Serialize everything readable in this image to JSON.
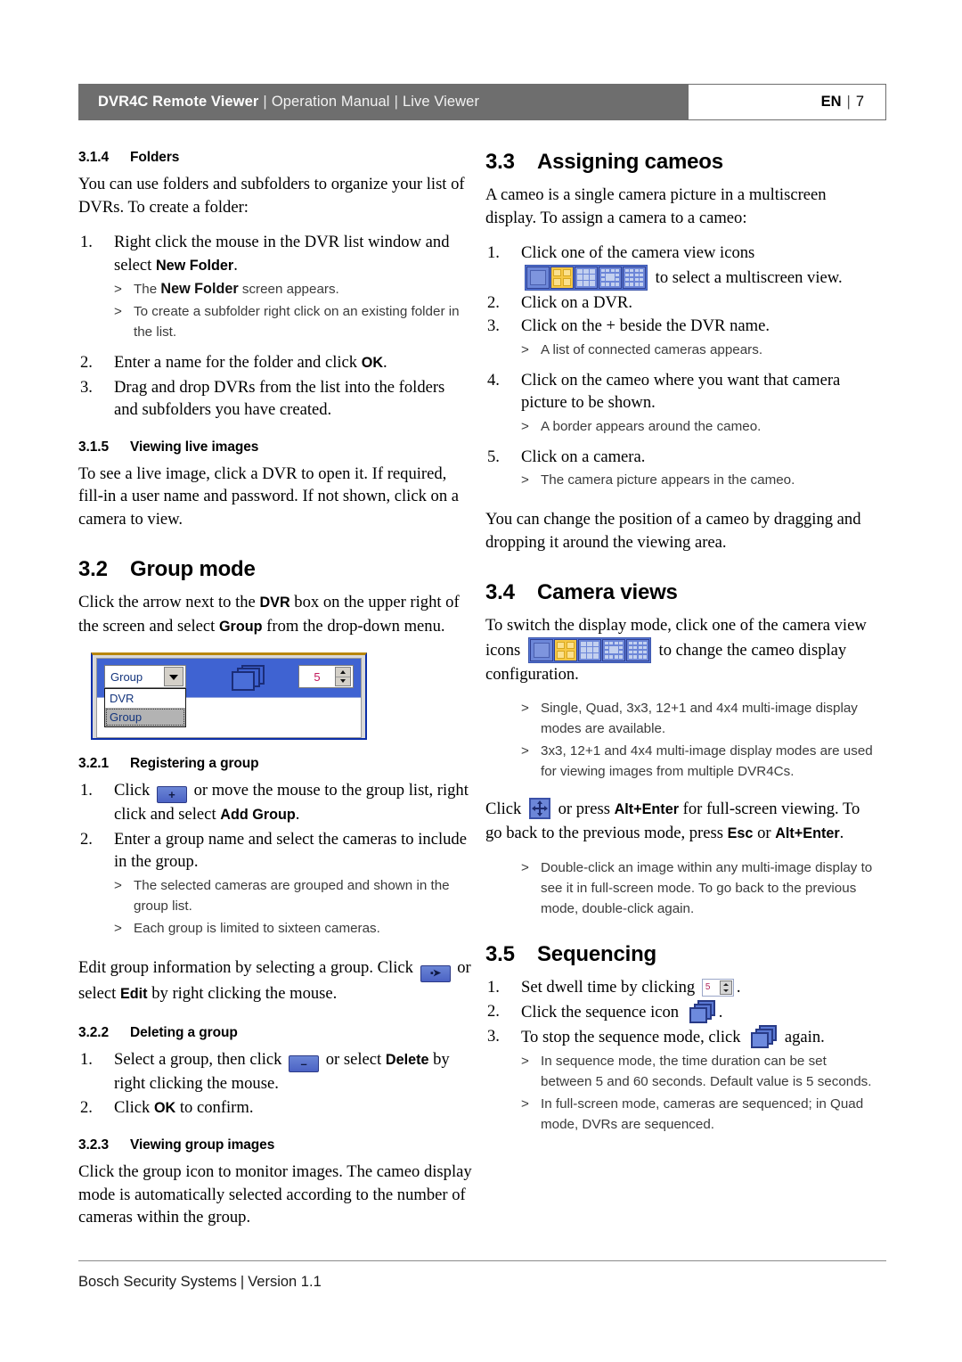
{
  "header": {
    "title": "DVR4C Remote Viewer",
    "sep1": "|",
    "subtitle1": "Operation Manual",
    "sep2": "|",
    "subtitle2": "Live Viewer",
    "language": "EN",
    "page_sep": "|",
    "page_number": "7"
  },
  "footer": {
    "company": "Bosch Security Systems",
    "sep": "|",
    "version": "Version 1.1"
  },
  "left_column": {
    "s314": {
      "number": "3.1.4",
      "title": "Folders",
      "intro": "You can use folders and subfolders to organize your list of DVRs. To create a folder:",
      "step1_num": "1.",
      "step1_a": "Right click the mouse in the DVR list window and select ",
      "step1_b": "New Folder",
      "step1_c": ".",
      "note1_a": "The ",
      "note1_b": "New Folder",
      "note1_c": " screen appears.",
      "note2": "To create a subfolder right click on an existing folder in the list.",
      "step2_num": "2.",
      "step2_a": "Enter a name for the folder and click ",
      "step2_b": "OK",
      "step2_c": ".",
      "step3_num": "3.",
      "step3": "Drag and drop DVRs from the list into the folders and subfolders you have created."
    },
    "s315": {
      "number": "3.1.5",
      "title": "Viewing live images",
      "body": "To see a live image, click a DVR to open it. If required, fill-in a user name and password. If not shown, click on a camera to view."
    },
    "s32": {
      "number": "3.2",
      "title": "Group mode",
      "body_a": "Click the arrow next to the ",
      "body_b": "DVR",
      "body_c": " box on the upper right of the screen and select ",
      "body_d": "Group",
      "body_e": " from the drop-down menu."
    },
    "figure": {
      "combo_value": "Group",
      "option_1": "DVR",
      "option_2": "Group",
      "spinner_value": "5",
      "combo_arrow_icon": "chevron-down-icon",
      "stack_icon": "sequence-stack-icon",
      "spinner_up_icon": "spinner-up-icon",
      "spinner_down_icon": "spinner-down-icon"
    },
    "s321": {
      "number": "3.2.1",
      "title": "Registering a group",
      "step1_num": "1.",
      "step1_a": "Click ",
      "step1_icon": "add-group-icon",
      "step1_icon_glyph": "+",
      "step1_b": " or move the mouse to the group list, right click and select ",
      "step1_c": "Add Group",
      "step1_d": ".",
      "step2_num": "2.",
      "step2": "Enter a group name and select the cameras to include in the group.",
      "note1": "The selected cameras are grouped and shown in the group list.",
      "note2": "Each group is limited to sixteen cameras.",
      "edit_a": "Edit group information by selecting a group. Click ",
      "edit_icon": "edit-group-icon",
      "edit_icon_glyph": "▪➤",
      "edit_b": " or select ",
      "edit_c": "Edit",
      "edit_d": " by right clicking the mouse."
    },
    "s322": {
      "number": "3.2.2",
      "title": "Deleting a group",
      "step1_num": "1.",
      "step1_a": "Select a group, then click ",
      "step1_icon": "delete-group-icon",
      "step1_icon_glyph": "–",
      "step1_b": " or select ",
      "step1_c": "Delete",
      "step1_d": " by right clicking the mouse.",
      "step2_num": "2.",
      "step2_a": "Click ",
      "step2_b": "OK",
      "step2_c": " to confirm."
    },
    "s323": {
      "number": "3.2.3",
      "title": "Viewing group images",
      "body": "Click the group icon to monitor images. The cameo display mode is automatically selected according to the number of cameras within the group."
    }
  },
  "right_column": {
    "s33": {
      "number": "3.3",
      "title": "Assigning cameos",
      "intro": "A cameo is a single camera picture in a multiscreen display. To assign a camera to a cameo:",
      "step1_num": "1.",
      "step1_a": "Click one of the camera view icons ",
      "step1_icon": "camera-view-icons",
      "step1_b": " to select a multiscreen view.",
      "step2_num": "2.",
      "step2": "Click on a DVR.",
      "step3_num": "3.",
      "step3": "Click on the + beside the DVR name.",
      "note3": "A list of connected cameras appears.",
      "step4_num": "4.",
      "step4": "Click on the cameo where you want that camera picture to be shown.",
      "note4": "A border appears around the cameo.",
      "step5_num": "5.",
      "step5": "Click on a camera.",
      "note5": "The camera picture appears in the cameo.",
      "outro": "You can change the position of a cameo by dragging and dropping it around the viewing area."
    },
    "s34": {
      "number": "3.4",
      "title": "Camera views",
      "body_a": "To switch the display mode, click one of the camera view icons ",
      "body_icon": "camera-view-icons",
      "body_b": " to change the cameo display configuration.",
      "note1": "Single, Quad, 3x3, 12+1 and 4x4 multi-image display modes are available.",
      "note2": "3x3, 12+1 and 4x4 multi-image display modes are used for viewing images from multiple DVR4Cs.",
      "full_a": "Click ",
      "full_icon": "full-screen-icon",
      "full_b": " or press ",
      "full_c": "Alt+Enter",
      "full_d": " for full-screen viewing. To go back to the previous mode, press ",
      "full_e": "Esc",
      "full_f": " or ",
      "full_g": "Alt+Enter",
      "full_h": ".",
      "note3": "Double-click an image within any multi-image display to see it in full-screen mode. To go back to the previous mode, double-click again."
    },
    "s35": {
      "number": "3.5",
      "title": "Sequencing",
      "step1_num": "1.",
      "step1_a": "Set dwell time by clicking ",
      "step1_icon": "dwell-time-spinner-icon",
      "step1_icon_value": "5",
      "step1_b": ".",
      "step2_num": "2.",
      "step2_a": "Click the sequence icon ",
      "step2_icon": "sequence-stack-icon",
      "step2_b": ".",
      "step3_num": "3.",
      "step3_a": "To stop the sequence mode, click ",
      "step3_icon": "sequence-stack-icon",
      "step3_b": " again.",
      "note1": "In sequence mode, the time duration can be set between 5 and 60 seconds. Default value is 5 seconds.",
      "note2": "In full-screen mode, cameras are sequenced; in Quad mode, DVRs are sequenced."
    }
  },
  "view_icons": {
    "labels": [
      "Single",
      "Quad",
      "3x3",
      "12+1",
      "4x4"
    ],
    "selected_index": 1
  },
  "colors": {
    "header_bar": "#6e6e6e",
    "ui_blue": "#3f63d2",
    "icon_blue": "#6c86d8",
    "selected_yellow": "#f6c846",
    "figure_border": "#0b2ea8"
  },
  "note_marker": ">"
}
